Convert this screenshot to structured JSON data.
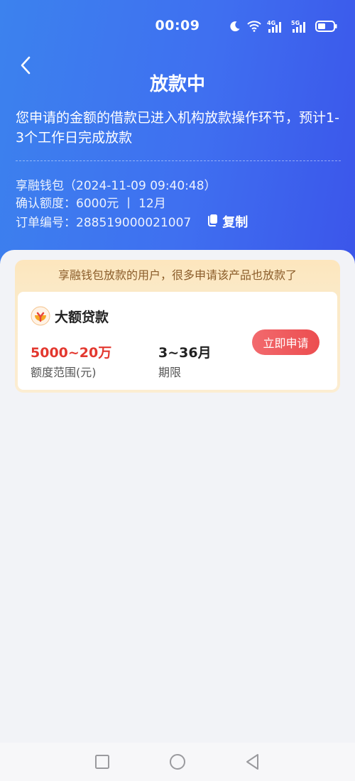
{
  "status_bar": {
    "time": "00:09",
    "icons": [
      "moon-icon",
      "wifi-icon",
      "signal-4g-icon",
      "signal-5g-icon",
      "battery-icon"
    ],
    "network_1": "4G",
    "network_2": "5G"
  },
  "header": {
    "title": "放款中",
    "back_icon": "chevron-left-icon"
  },
  "notice": "您申请的金额的借款已进入机构放款操作环节，预计1-3个工作日完成放款",
  "order": {
    "platform_line": "享融钱包（2024-11-09 09:40:48）",
    "amount_line": "确认额度：6000元 丨 12月",
    "order_line": "订单编号：288519000021007",
    "copy_label": "复制"
  },
  "promo": {
    "banner": "享融钱包放款的用户，很多申请该产品也放款了",
    "product_name": "大额贷款",
    "amount_value": "5000~20万",
    "amount_label": "额度范围(元)",
    "term_value": "3~36月",
    "term_label": "期限",
    "apply_label": "立即申请"
  },
  "colors": {
    "header_gradient_start": "#3c82ee",
    "header_gradient_end": "#3b55ea",
    "accent_red": "#e3382f",
    "apply_button": "#ec4d4f",
    "banner_text": "#8b5d2a",
    "page_background": "#f2f3f7"
  },
  "nav_bar": {
    "icons": [
      "square-icon",
      "circle-icon",
      "triangle-back-icon"
    ]
  }
}
